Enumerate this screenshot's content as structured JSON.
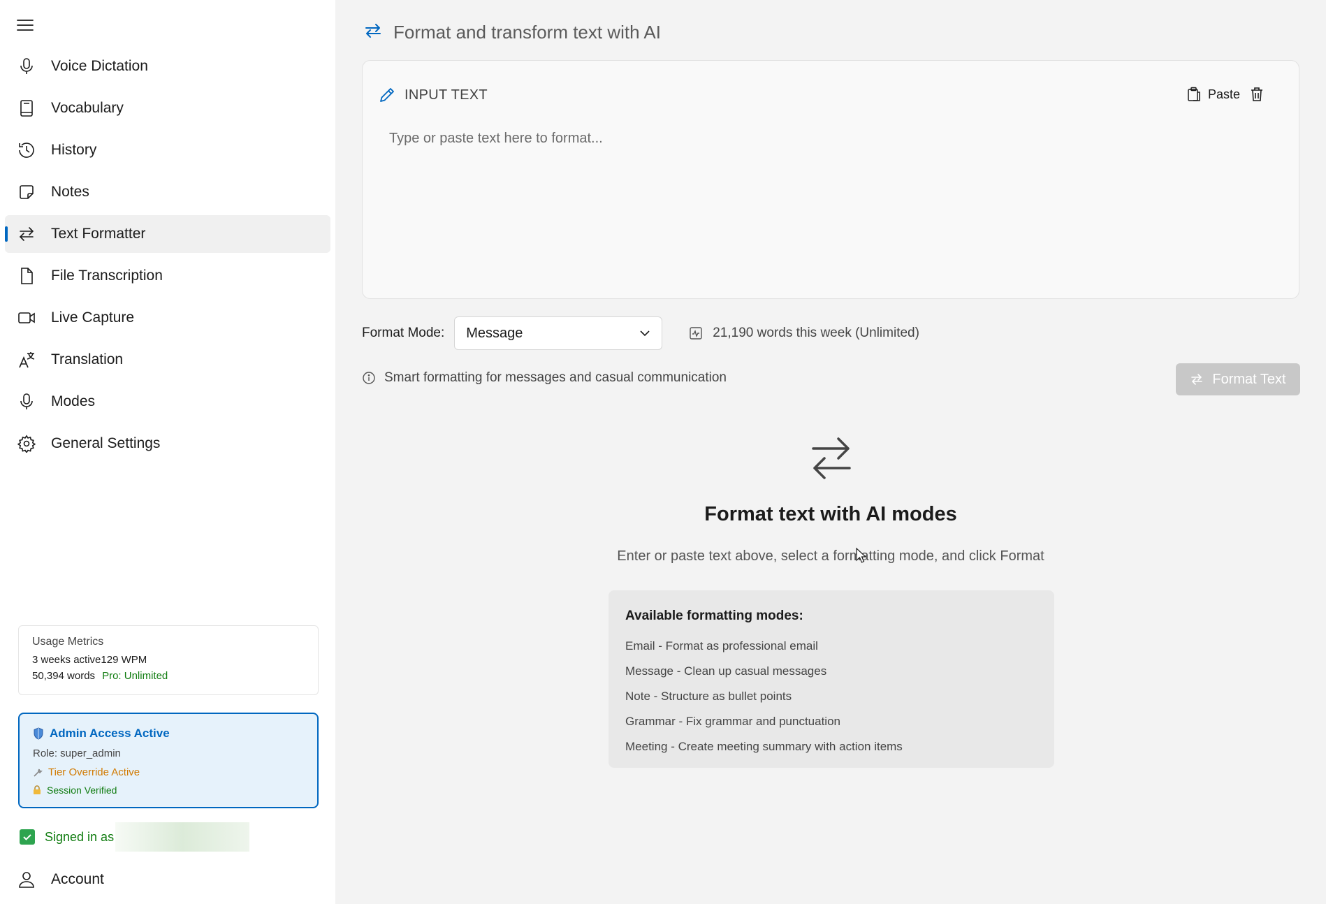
{
  "sidebar": {
    "items": [
      {
        "label": "Voice Dictation",
        "icon": "microphone-icon"
      },
      {
        "label": "Vocabulary",
        "icon": "book-icon"
      },
      {
        "label": "History",
        "icon": "history-icon"
      },
      {
        "label": "Notes",
        "icon": "note-icon"
      },
      {
        "label": "Text Formatter",
        "icon": "swap-arrows-icon",
        "active": true
      },
      {
        "label": "File Transcription",
        "icon": "file-icon"
      },
      {
        "label": "Live Capture",
        "icon": "video-camera-icon"
      },
      {
        "label": "Translation",
        "icon": "translate-icon"
      },
      {
        "label": "Modes",
        "icon": "microphone-icon"
      },
      {
        "label": "General Settings",
        "icon": "gear-icon"
      }
    ],
    "metrics": {
      "title": "Usage Metrics",
      "weeks_active": "3 weeks active",
      "wpm": "129 WPM",
      "words": "50,394 words",
      "plan": "Pro: Unlimited"
    },
    "admin": {
      "title": "Admin Access Active",
      "role": "Role: super_admin",
      "tier": "Tier Override Active",
      "session": "Session Verified"
    },
    "signed_in": "Signed in as",
    "account_label": "Account"
  },
  "main": {
    "header_title": "Format and transform text with AI",
    "input": {
      "label": "INPUT TEXT",
      "paste_label": "Paste",
      "placeholder": "Type or paste text here to format...",
      "value": ""
    },
    "format_mode_label": "Format Mode:",
    "format_mode_value": "Message",
    "usage_text": "21,190 words this week (Unlimited)",
    "info_text": "Smart formatting for messages and casual communication",
    "format_button": "Format Text",
    "empty": {
      "title": "Format text with AI modes",
      "subtitle": "Enter or paste text above, select a formatting mode, and click Format",
      "modes_title": "Available formatting modes:",
      "modes": [
        "Email - Format as professional email",
        "Message - Clean up casual messages",
        "Note - Structure as bullet points",
        "Grammar - Fix grammar and punctuation",
        "Meeting - Create meeting summary with action items"
      ]
    }
  },
  "colors": {
    "accent": "#0067c0",
    "success": "#107c10",
    "warning": "#d17a00",
    "disabled_button": "#c8c8c8"
  }
}
